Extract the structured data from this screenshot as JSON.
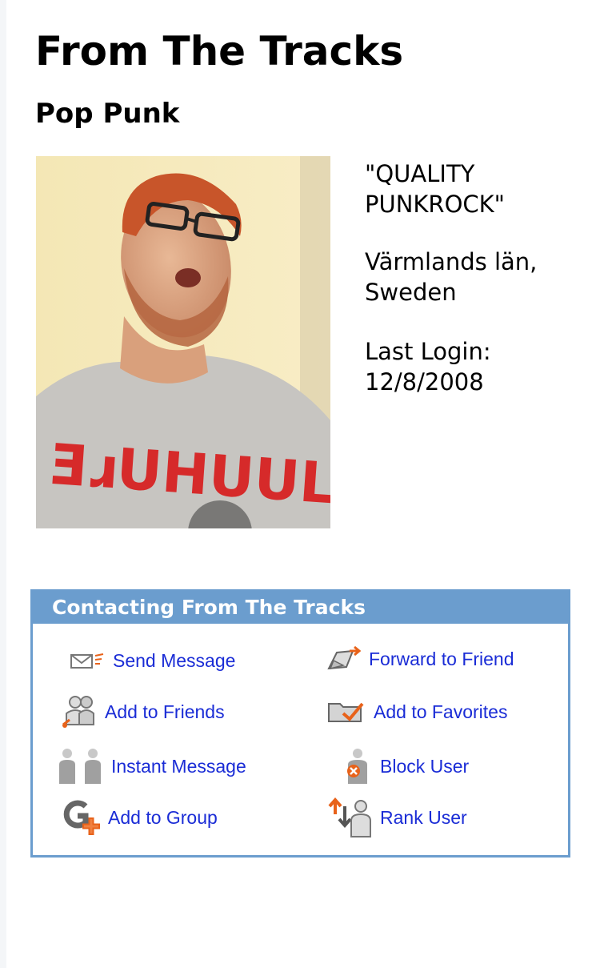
{
  "profile": {
    "name": "From The Tracks",
    "genre": "Pop Punk",
    "headline": "\"QUALITY PUNKROCK\"",
    "location": "Värmlands län, Sweden",
    "last_login": "Last Login: 12/8/2008"
  },
  "contact": {
    "title": "Contacting From The Tracks",
    "actions": {
      "send_message": {
        "label": "Send Message",
        "icon": "envelope-icon"
      },
      "forward_to_friend": {
        "label": "Forward to Friend",
        "icon": "forward-icon"
      },
      "add_to_friends": {
        "label": "Add to Friends",
        "icon": "add-friend-icon"
      },
      "add_to_favorites": {
        "label": "Add to Favorites",
        "icon": "favorites-folder-icon"
      },
      "instant_message": {
        "label": "Instant Message",
        "icon": "instant-message-icon"
      },
      "block_user": {
        "label": "Block User",
        "icon": "block-user-icon"
      },
      "add_to_group": {
        "label": "Add to Group",
        "icon": "add-group-icon"
      },
      "rank_user": {
        "label": "Rank User",
        "icon": "rank-user-icon"
      }
    }
  },
  "colors": {
    "header_bg": "#6b9dce",
    "link": "#1a2cd6",
    "icon_orange": "#e8621a",
    "icon_gray": "#9a9a9a"
  }
}
